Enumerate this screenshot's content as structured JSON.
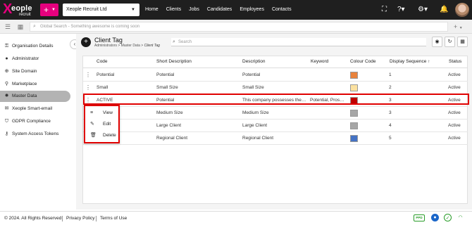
{
  "brand": {
    "logo_letter": "X",
    "logo_word": "eople",
    "logo_sub": "recruit",
    "accent": "#e6007e"
  },
  "topbar": {
    "add_label": "+",
    "company": "Xeople Recruit Ltd",
    "nav": [
      "Home",
      "Clients",
      "Jobs",
      "Candidates",
      "Employees",
      "Contacts"
    ]
  },
  "global_search": {
    "placeholder": "Global Search - Something awesome is coming soon"
  },
  "sidebar": {
    "items": [
      {
        "label": "Organisation Details",
        "icon": "key-icon"
      },
      {
        "label": "Administrator",
        "icon": "person-icon"
      },
      {
        "label": "Site Domain",
        "icon": "globe-icon"
      },
      {
        "label": "Marketplace",
        "icon": "pin-icon"
      },
      {
        "label": "Master Data",
        "icon": "settings-icon",
        "active": true
      },
      {
        "label": "Xeople Smart-email",
        "icon": "email-icon"
      },
      {
        "label": "GDPR Compliance",
        "icon": "shield-icon"
      },
      {
        "label": "System Access Tokens",
        "icon": "token-icon"
      }
    ]
  },
  "page": {
    "title": "Client Tag",
    "breadcrumb": [
      "Administrators",
      "Master Data"
    ],
    "breadcrumb_current": "Client Tag",
    "search_placeholder": "Search"
  },
  "table": {
    "columns": [
      "Code",
      "Short Description",
      "Description",
      "Keyword",
      "Colour Code",
      "Display Sequence",
      "Status"
    ],
    "sort_indicator": "↑",
    "rows": [
      {
        "code": "Potential",
        "short": "Potential",
        "desc": "Potential",
        "keyword": "",
        "color": "#e8823c",
        "seq": "1",
        "status": "Active"
      },
      {
        "code": "Small",
        "short": "Small Size",
        "desc": "Small Size",
        "keyword": "",
        "color": "#fbe1a0",
        "seq": "2",
        "status": "Active"
      },
      {
        "code": "ACTIVE",
        "short": "Potential",
        "desc": "This company possesses the…",
        "keyword": "Potential, Pros…",
        "color": "#c00000",
        "seq": "3",
        "status": "Active"
      },
      {
        "code": "",
        "short": "Medium Size",
        "desc": "Medium Size",
        "keyword": "",
        "color": "#a6a6a6",
        "seq": "3",
        "status": "Active"
      },
      {
        "code": "",
        "short": "Large Client",
        "desc": "Large Client",
        "keyword": "",
        "color": "#a6a6a6",
        "seq": "4",
        "status": "Active"
      },
      {
        "code": "",
        "short": "Regional Client",
        "desc": "Regional Client",
        "keyword": "",
        "color": "#4472c4",
        "seq": "5",
        "status": "Active"
      }
    ]
  },
  "context_menu": {
    "items": [
      {
        "label": "View",
        "icon": "list-icon"
      },
      {
        "label": "Edit",
        "icon": "pencil-icon"
      },
      {
        "label": "Delete",
        "icon": "trash-icon"
      }
    ]
  },
  "footer": {
    "copyright": "© 2024. All Rights Reserved",
    "privacy": "Privacy Policy",
    "terms": "Terms of Use",
    "badge": "PPD"
  }
}
